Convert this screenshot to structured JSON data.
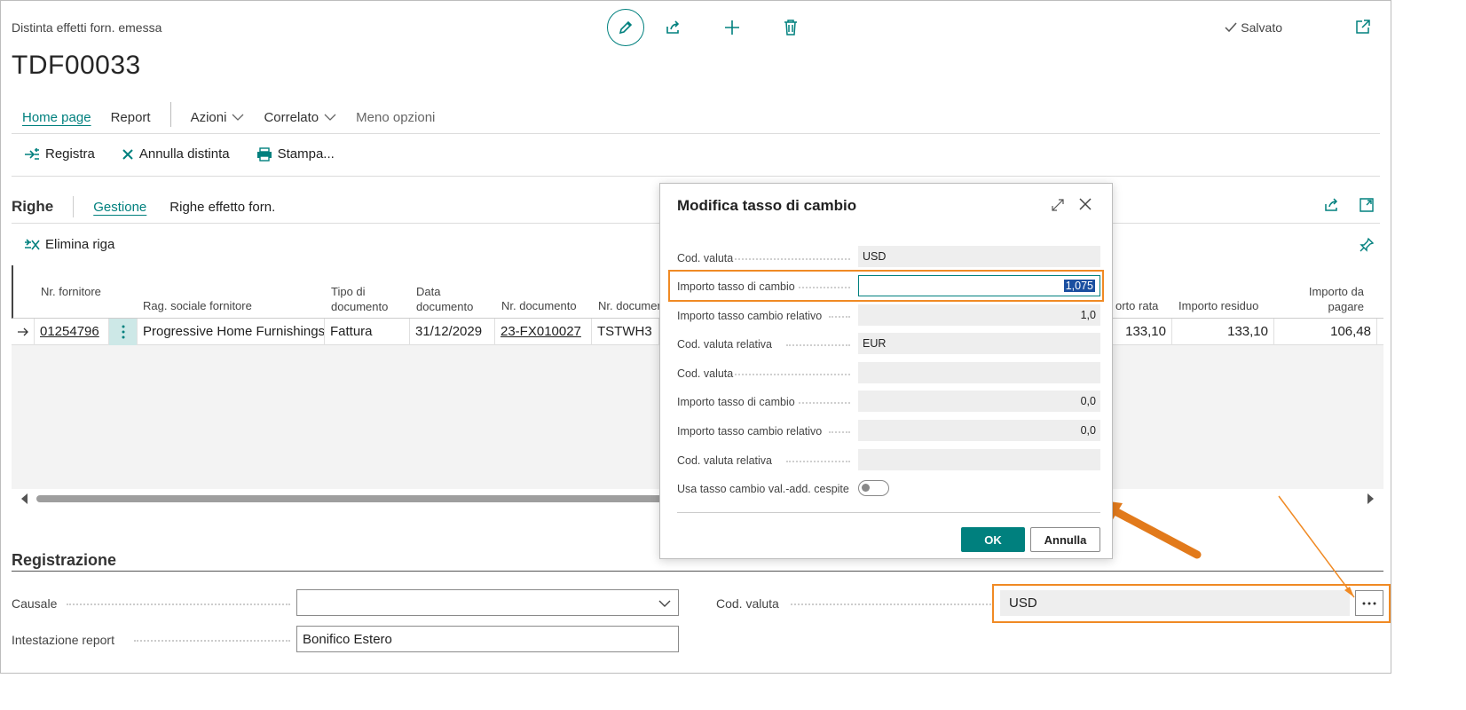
{
  "header": {
    "subtitle": "Distinta effetti forn. emessa",
    "title": "TDF00033",
    "saved_label": "Salvato"
  },
  "nav": {
    "items": [
      "Home page",
      "Report",
      "Azioni",
      "Correlato",
      "Meno opzioni"
    ]
  },
  "actions": {
    "registra": "Registra",
    "annulla": "Annulla distinta",
    "stampa": "Stampa..."
  },
  "lines": {
    "title": "Righe",
    "tab_gestione": "Gestione",
    "tab_righe": "Righe effetto forn.",
    "delete_line": "Elimina riga",
    "columns": {
      "supplier_no": "Nr. fornitore",
      "supplier_name": "Rag. sociale fornitore",
      "doc_type": "Tipo di documento",
      "doc_date": "Data documento",
      "doc_no": "Nr. documento",
      "doc_no2": "Nr. documen",
      "installment": "orto rata",
      "remaining": "Importo residuo",
      "to_pay": "Importo da pagare"
    },
    "row": {
      "supplier_no": "01254796",
      "supplier_name": "Progressive Home Furnishings",
      "doc_type": "Fattura",
      "doc_date": "31/12/2029",
      "doc_no": "23-FX010027",
      "doc_no2": "TSTWH3",
      "installment": "133,10",
      "remaining": "133,10",
      "to_pay": "106,48"
    }
  },
  "posting": {
    "title": "Registrazione",
    "causale_label": "Causale",
    "causale_value": "",
    "report_header_label": "Intestazione report",
    "report_header_value": "Bonifico Estero",
    "currency_label": "Cod. valuta",
    "currency_value": "USD"
  },
  "dialog": {
    "title": "Modifica tasso di cambio",
    "rows": [
      {
        "label": "Cod. valuta",
        "value": "USD"
      },
      {
        "label": "Importo tasso di cambio",
        "value": "1,075"
      },
      {
        "label": "Importo tasso cambio relativo",
        "value": "1,0"
      },
      {
        "label": "Cod. valuta relativa",
        "value": "EUR"
      },
      {
        "label": "Cod. valuta",
        "value": ""
      },
      {
        "label": "Importo tasso di cambio",
        "value": "0,0"
      },
      {
        "label": "Importo tasso cambio relativo",
        "value": "0,0"
      },
      {
        "label": "Cod. valuta relativa",
        "value": ""
      },
      {
        "label": "Usa tasso cambio val.-add. cespite",
        "value": ""
      }
    ],
    "ok": "OK",
    "cancel": "Annulla"
  },
  "colors": {
    "accent": "#00807e",
    "highlight": "#f08a24"
  }
}
